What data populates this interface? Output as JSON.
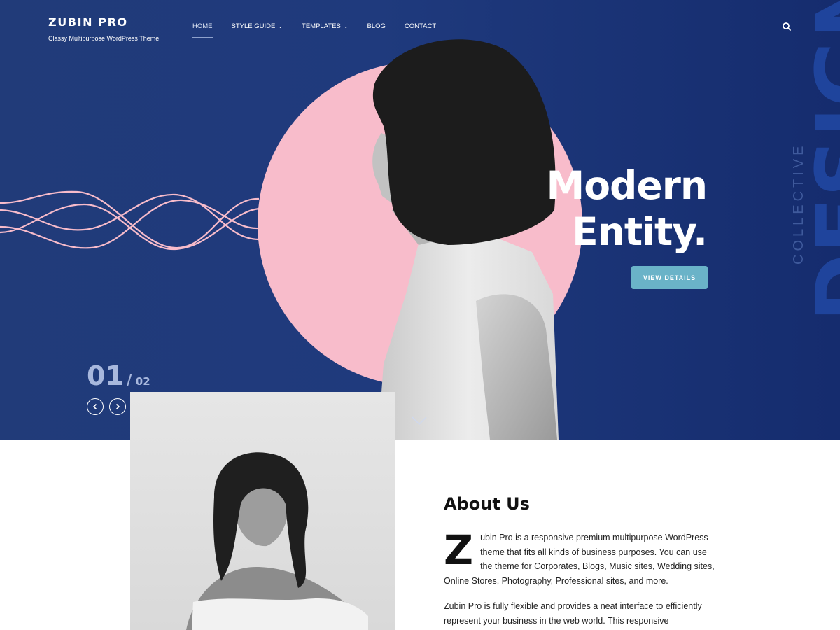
{
  "brand": {
    "title": "ZUBIN PRO",
    "tagline": "Classy Multipurpose WordPress Theme"
  },
  "nav": {
    "items": [
      {
        "label": "HOME",
        "active": true,
        "dropdown": false
      },
      {
        "label": "STYLE GUIDE",
        "active": false,
        "dropdown": true
      },
      {
        "label": "TEMPLATES",
        "active": false,
        "dropdown": true
      },
      {
        "label": "BLOG",
        "active": false,
        "dropdown": false
      },
      {
        "label": "CONTACT",
        "active": false,
        "dropdown": false
      }
    ],
    "search_icon": "search-icon"
  },
  "hero": {
    "headline_line1": "Modern",
    "headline_line2": "Entity.",
    "button_label": "VIEW DETAILS",
    "side_word_small": "COLLECTIVE",
    "side_word_large": "DESIGN",
    "slide_current": "01",
    "slide_separator": "/",
    "slide_total": "02",
    "colors": {
      "background": "#1f3a7d",
      "circle": "#f8bccb",
      "button": "#6ab3c8"
    }
  },
  "about": {
    "title": "About Us",
    "dropcap": "Z",
    "paragraph1": "ubin Pro is a responsive premium multipurpose WordPress theme that fits all kinds of business purposes. You can use the theme for Corporates, Blogs, Music sites, Wedding sites, Online Stores, Photography, Professional sites, and more.",
    "paragraph2": "Zubin Pro is fully flexible and provides a neat interface to efficiently represent your business in the web world. This responsive"
  }
}
